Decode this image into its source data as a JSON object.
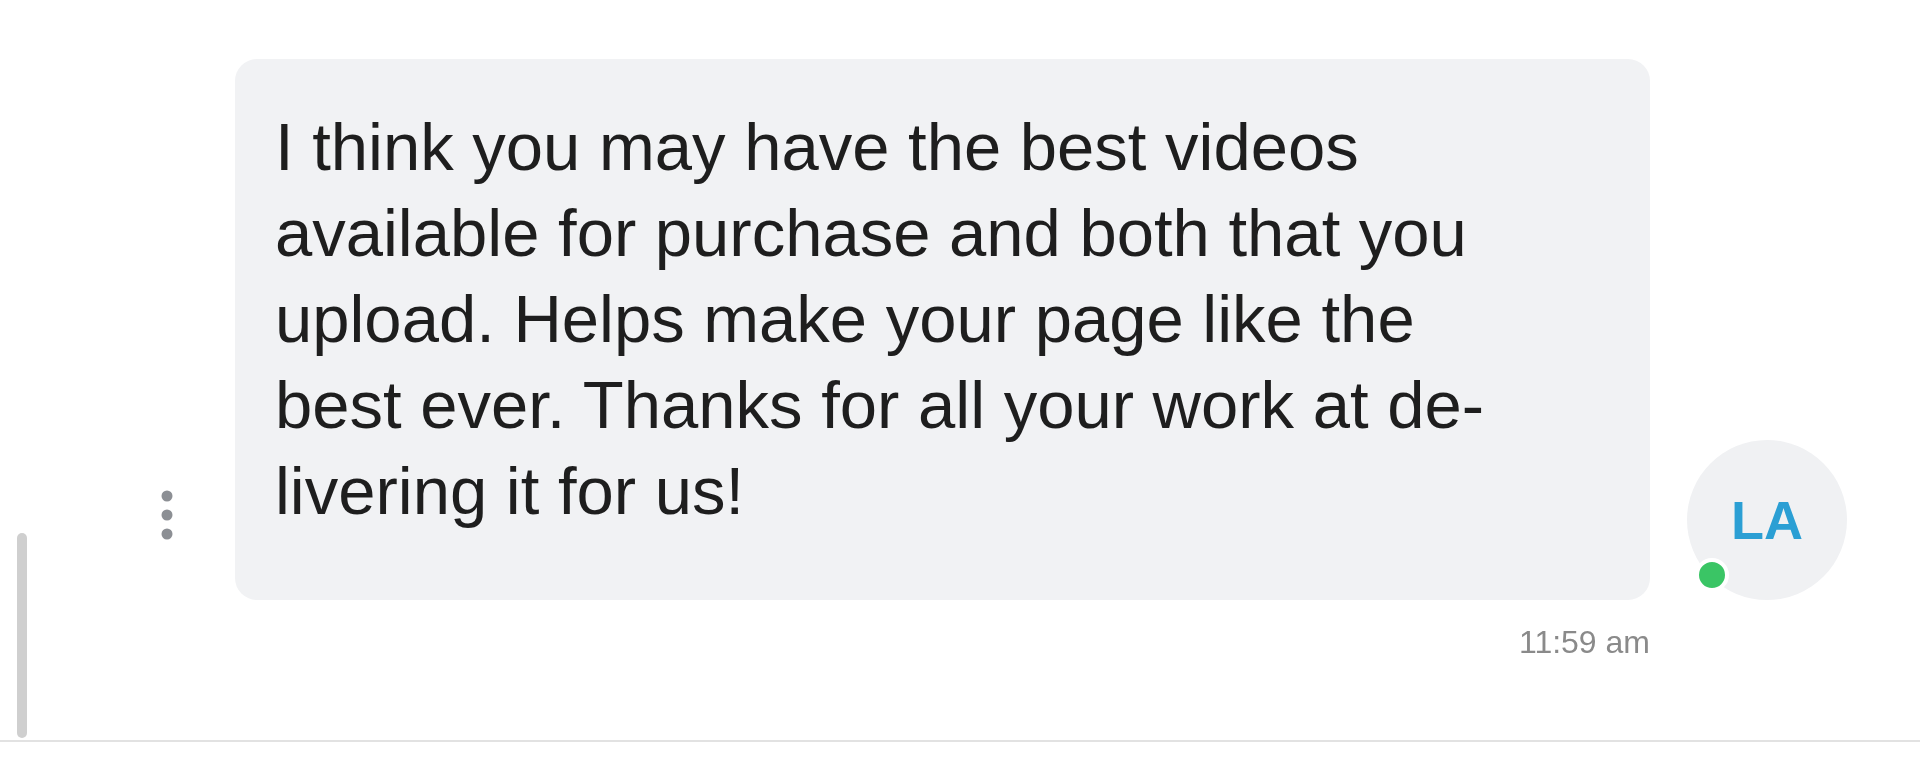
{
  "mirrored": true,
  "message": {
    "text": "I think you may have the best videos\navailable for purchase and both that you\nupload. Helps make your page like the\nbest ever. Thanks for all your work at de-\nlivering it for us!",
    "time": "11:59 am"
  },
  "avatar": {
    "initials": "LA",
    "online": true
  }
}
